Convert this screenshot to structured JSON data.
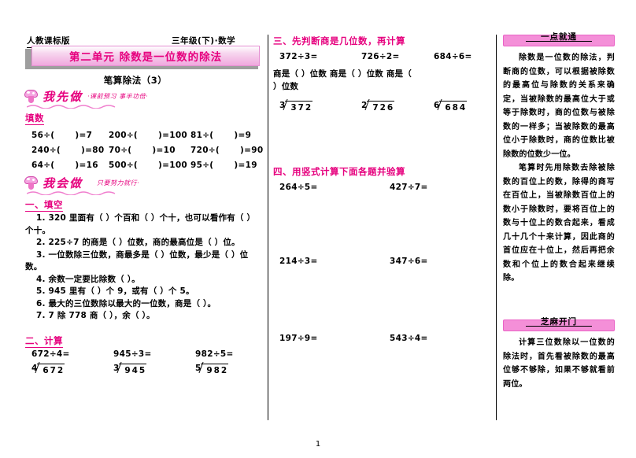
{
  "header": {
    "edition": "人教课标版",
    "grade_subject": "三年级(下)·数学",
    "unit_title": "第二单元  除数是一位数的除法",
    "lesson_subtitle": "笔算除法（3）"
  },
  "left_column": {
    "doodle_first": {
      "title": "我先做",
      "note": "·课前预习  事半功倍·"
    },
    "warmup_heading": "填数",
    "warmup_rows": [
      [
        "56÷(",
        ")=7",
        "200÷(",
        ")=100",
        "81÷(",
        ")=9"
      ],
      [
        "240÷(",
        ")=80",
        "70÷(",
        ")=10",
        "720÷(",
        ")=90"
      ],
      [
        "64÷(",
        ")=16",
        "500÷(",
        ")=100",
        "95÷(",
        ")=19"
      ]
    ],
    "doodle_second": {
      "title": "我会做",
      "note": "只要努力就行·"
    },
    "sec1_heading": "一、填空",
    "sec1_items": [
      "1. 320 里面有（     ）个百和（     ）个十，也可以看作有（     ）个十。",
      "2. 225÷7 的商是（      ）位数，商的最高位是（  ）位。",
      "3. 一位数除三位数，商最多是（      ）位数，最少是（ ）位数。",
      "4. 余数一定要比除数（     ）。",
      "5. 945 里有（     ）个 9，或有（     ）个 5。",
      "6. 最大的三位数除以最大的一位数，商是（     ）。",
      "7. 7 除 778 商（     ），余（     ）。"
    ],
    "sec2_heading": "二、计算",
    "sec2_problems": [
      {
        "expr": "672÷4=",
        "divisor": "4",
        "dividend": "672"
      },
      {
        "expr": "945÷3=",
        "divisor": "3",
        "dividend": "945"
      },
      {
        "expr": "982÷5=",
        "divisor": "5",
        "dividend": "982"
      }
    ]
  },
  "middle_column": {
    "sec3_heading": "三、先判断商是几位数，再计算",
    "sec3_problems": [
      {
        "expr": "372÷3=",
        "divisor": "3",
        "dividend": "372"
      },
      {
        "expr": "726÷2=",
        "divisor": "2",
        "dividend": "726"
      },
      {
        "expr": "684÷6=",
        "divisor": "6",
        "dividend": "684"
      }
    ],
    "sec3_prompt_a": "商是（     ）位数   商是（     ）位数  商是（",
    "sec3_prompt_b": "）位数",
    "sec4_heading": "四、用竖式计算下面各题并验算",
    "sec4_problems": [
      [
        "264÷5=",
        "427÷7="
      ],
      [
        "214÷3=",
        "347÷6="
      ],
      [
        "197÷9=",
        "543÷4="
      ]
    ]
  },
  "right_column": {
    "tip1": {
      "title": "一点就通",
      "body": "除数是一位数的除法，判断商的位数，可以根据被除数的最高位与除数的关系来确定，当被除数的最高位大于或等于除数时，商的位数与被除数的一样多；当被除数的最高位小于除数时，商的位数比被除数的位数少一位。",
      "body2": "笔算时先用除数去除被除数的百位上的数，除得的商写在百位上，当被除数百位上的数小于除数时，要将百位上的数与十位上的数合起来，看成几十几个十来计算，因此商的首位应在十位上，然后再把余数和个位上的数合起来继续除。"
    },
    "tip2": {
      "title": "芝麻开门",
      "body": "计算三位数除以一位数的除法时，首先看被除数的最高位够不够除，如果不够就看前两位。"
    }
  },
  "footer": {
    "page_number": "1"
  }
}
